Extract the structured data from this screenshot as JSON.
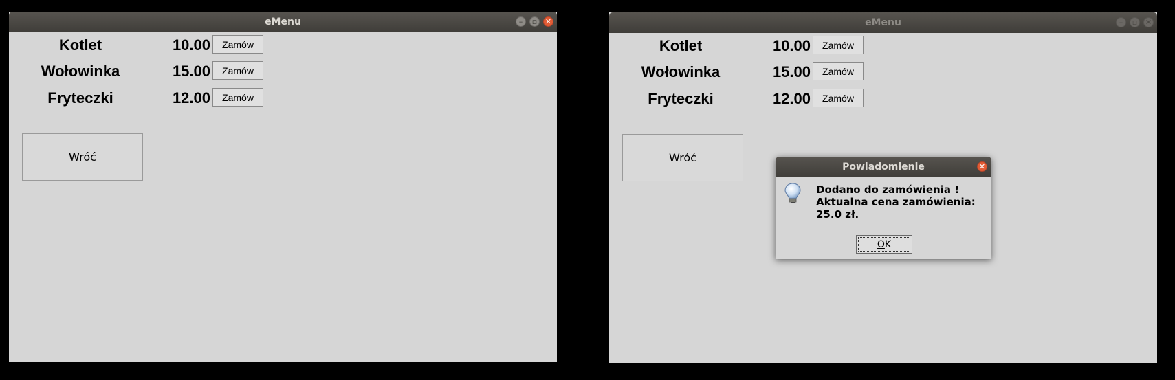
{
  "windows": [
    {
      "title": "eMenu",
      "items": [
        {
          "name": "Kotlet",
          "price": "10.00",
          "button": "Zamów"
        },
        {
          "name": "Wołowinka",
          "price": "15.00",
          "button": "Zamów"
        },
        {
          "name": "Fryteczki",
          "price": "12.00",
          "button": "Zamów"
        }
      ],
      "back_label": "Wróć"
    },
    {
      "title": "eMenu",
      "items": [
        {
          "name": "Kotlet",
          "price": "10.00",
          "button": "Zamów"
        },
        {
          "name": "Wołowinka",
          "price": "15.00",
          "button": "Zamów"
        },
        {
          "name": "Fryteczki",
          "price": "12.00",
          "button": "Zamów"
        }
      ],
      "back_label": "Wróć"
    }
  ],
  "dialog": {
    "title": "Powiadomienie",
    "message_lines": [
      "Dodano do zamówienia !",
      "Aktualna cena zamówienia:",
      "25.0 zł."
    ],
    "ok_mnemonic": "O",
    "ok_rest": "K",
    "icon": "lightbulb-icon"
  },
  "colors": {
    "titlebar": "#45423e",
    "close_button": "#e25c35",
    "window_bg": "#d6d6d6"
  }
}
